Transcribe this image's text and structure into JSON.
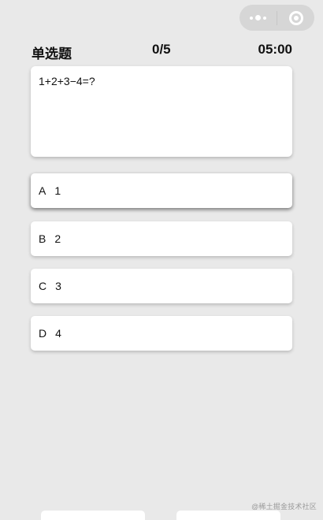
{
  "capsule": {
    "more_icon": "more-dots-icon",
    "close_icon": "target-close-icon"
  },
  "header": {
    "question_type": "单选题",
    "progress": "0/5",
    "timer": "05:00"
  },
  "question": {
    "text": "1+2+3−4=?"
  },
  "options": [
    {
      "letter": "A",
      "value": "1"
    },
    {
      "letter": "B",
      "value": "2"
    },
    {
      "letter": "C",
      "value": "3"
    },
    {
      "letter": "D",
      "value": "4"
    }
  ],
  "watermark": "@稀土掘金技术社区",
  "colors": {
    "background": "#e9e9e9",
    "card": "#ffffff",
    "text": "#111111"
  }
}
